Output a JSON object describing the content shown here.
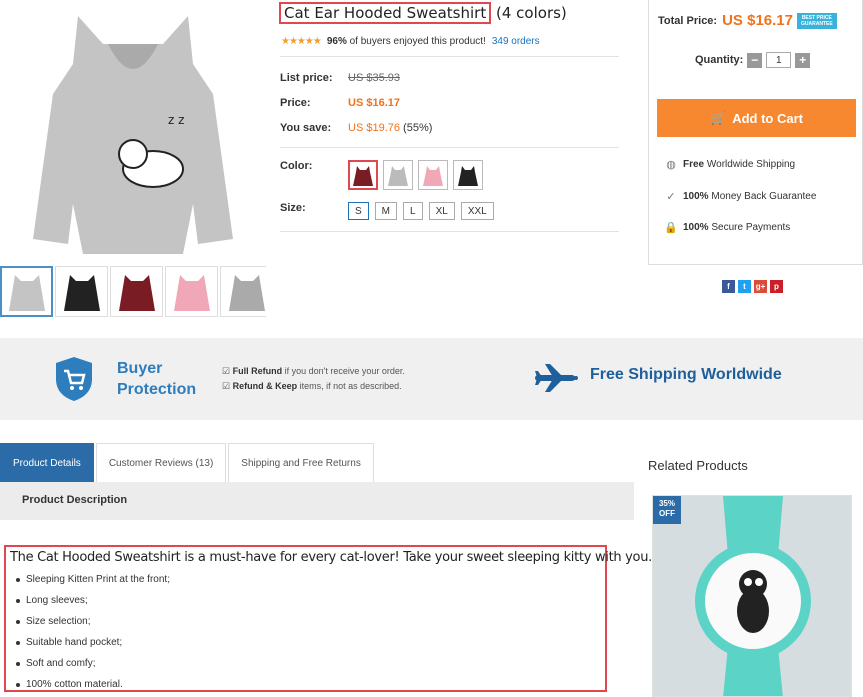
{
  "product": {
    "title": "Cat Ear Hooded Sweatshirt",
    "title_suffix": "(4 colors)",
    "rating_percent": "96%",
    "rating_text": "of buyers enjoyed this product!",
    "orders": "349 orders",
    "list_price_label": "List price:",
    "list_price": "US $35.93",
    "price_label": "Price:",
    "price": "US $16.17",
    "save_label": "You save:",
    "save_value": "US $19.76",
    "save_pct": "(55%)",
    "color_label": "Color:",
    "colors": [
      "wine",
      "grey",
      "pink",
      "black"
    ],
    "size_label": "Size:",
    "sizes": [
      "S",
      "M",
      "L",
      "XL",
      "XXL"
    ],
    "selected_size": "S"
  },
  "cart": {
    "total_label": "Total Price:",
    "total": "US $16.17",
    "badge_line1": "BEST PRICE",
    "badge_line2": "GUARANTEE",
    "qty_label": "Quantity:",
    "qty": "1",
    "add_label": "Add to Cart",
    "f1_bold": "Free",
    "f1_text": "Worldwide Shipping",
    "f2_bold": "100%",
    "f2_text": "Money Back Guarantee",
    "f3_bold": "100%",
    "f3_text": "Secure Payments"
  },
  "band": {
    "buyer": "Buyer",
    "protection": "Protection",
    "r1_bold": "Full Refund",
    "r1_text": "if you don't receive your order.",
    "r2_bold": "Refund & Keep",
    "r2_text": "items, if not as described.",
    "shipping": "Free Shipping Worldwide"
  },
  "tabs": [
    "Product Details",
    "Customer Reviews (13)",
    "Shipping and Free Returns"
  ],
  "desc": {
    "heading": "Product Description",
    "intro": "The Cat Hooded Sweatshirt is a must-have for every cat-lover! Take your sweet sleeping kitty with you.",
    "bullets": [
      "Sleeping Kitten Print at the front;",
      "Long sleeves;",
      "Size selection;",
      "Suitable hand pocket;",
      "Soft and comfy;",
      "100% cotton material."
    ]
  },
  "related": {
    "title": "Related Products",
    "off_pct": "35%",
    "off_label": "OFF"
  },
  "colors": {
    "accent_orange": "#f7882f",
    "price_orange": "#f0721b",
    "brand_blue": "#2b6ca8",
    "highlight_red": "#e0484f"
  }
}
